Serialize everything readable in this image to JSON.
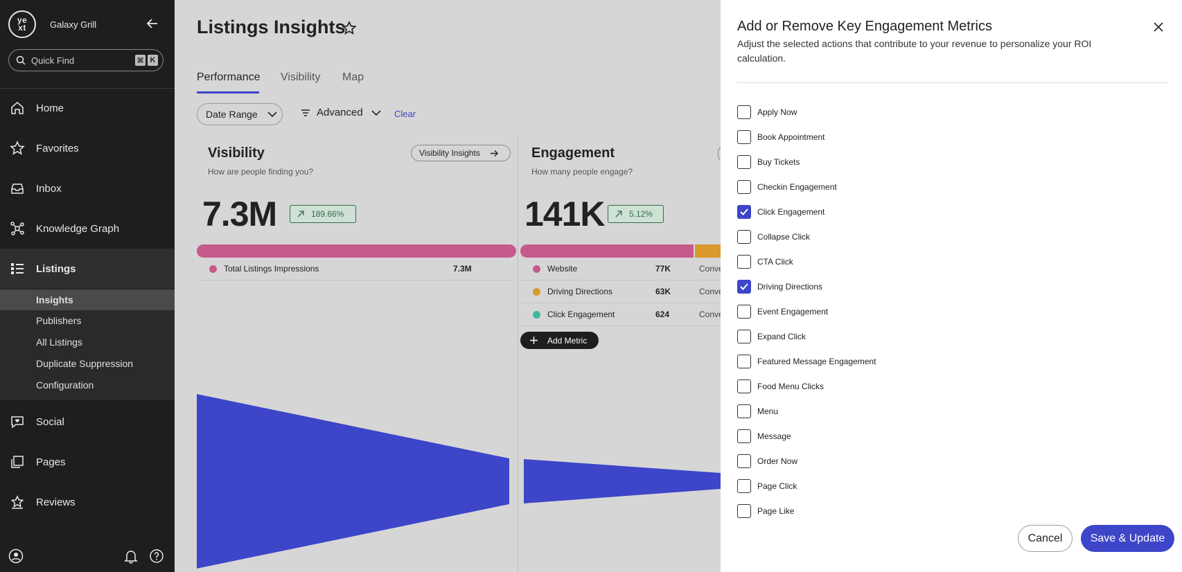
{
  "sidebar": {
    "brand_name": "Galaxy Grill",
    "logo_text": "ye xt",
    "quickfind": {
      "label": "Quick Find",
      "key1": "⌘",
      "key2": "K"
    },
    "items": [
      {
        "label": "Home",
        "icon": "home-icon"
      },
      {
        "label": "Favorites",
        "icon": "star-icon"
      },
      {
        "label": "Inbox",
        "icon": "inbox-icon"
      },
      {
        "label": "Knowledge Graph",
        "icon": "knowledge-graph-icon"
      },
      {
        "label": "Listings",
        "icon": "listings-icon"
      },
      {
        "label": "Social",
        "icon": "social-icon"
      },
      {
        "label": "Pages",
        "icon": "pages-icon"
      },
      {
        "label": "Reviews",
        "icon": "reviews-icon"
      }
    ],
    "sub_items": [
      "Insights",
      "Publishers",
      "All Listings",
      "Duplicate Suppression",
      "Configuration"
    ]
  },
  "main": {
    "title": "Listings Insights",
    "tabs": [
      "Performance",
      "Visibility",
      "Map"
    ],
    "filters": {
      "date_range": "Date Range",
      "advanced": "Advanced",
      "clear": "Clear"
    },
    "visibility": {
      "title": "Visibility",
      "subtitle": "How are people finding you?",
      "button": "Visibility Insights",
      "total": "7.3M",
      "change": "189.66%",
      "rows": [
        {
          "label": "Total Listings Impressions",
          "value": "7.3M",
          "color": "#c65a8a"
        }
      ]
    },
    "engagement": {
      "title": "Engagement",
      "subtitle": "How many people engage?",
      "total": "141K",
      "change": "5.12%",
      "rows": [
        {
          "label": "Website",
          "value": "77K",
          "conv": "Conve",
          "color": "#c65a8a"
        },
        {
          "label": "Driving Directions",
          "value": "63K",
          "conv": "Conve",
          "color": "#d99a2b"
        },
        {
          "label": "Click Engagement",
          "value": "624",
          "conv": "Conve",
          "color": "#3fb89a"
        }
      ],
      "add_metric": "Add Metric"
    }
  },
  "panel": {
    "title": "Add or Remove Key Engagement Metrics",
    "description": "Adjust the selected actions that contribute to your revenue to personalize your ROI calculation.",
    "options": [
      {
        "label": "Apply Now",
        "checked": false
      },
      {
        "label": "Book Appointment",
        "checked": false
      },
      {
        "label": "Buy Tickets",
        "checked": false
      },
      {
        "label": "Checkin Engagement",
        "checked": false
      },
      {
        "label": "Click Engagement",
        "checked": true
      },
      {
        "label": "Collapse Click",
        "checked": false
      },
      {
        "label": "CTA Click",
        "checked": false
      },
      {
        "label": "Driving Directions",
        "checked": true
      },
      {
        "label": "Event Engagement",
        "checked": false
      },
      {
        "label": "Expand Click",
        "checked": false
      },
      {
        "label": "Featured Message Engagement",
        "checked": false
      },
      {
        "label": "Food Menu Clicks",
        "checked": false
      },
      {
        "label": "Menu",
        "checked": false
      },
      {
        "label": "Message",
        "checked": false
      },
      {
        "label": "Order Now",
        "checked": false
      },
      {
        "label": "Page Click",
        "checked": false
      },
      {
        "label": "Page Like",
        "checked": false
      }
    ],
    "cancel": "Cancel",
    "save": "Save & Update"
  },
  "colors": {
    "accent": "#3d45c8",
    "sidebar_bg": "#1e1e20",
    "funnel": "#3d45c8"
  }
}
